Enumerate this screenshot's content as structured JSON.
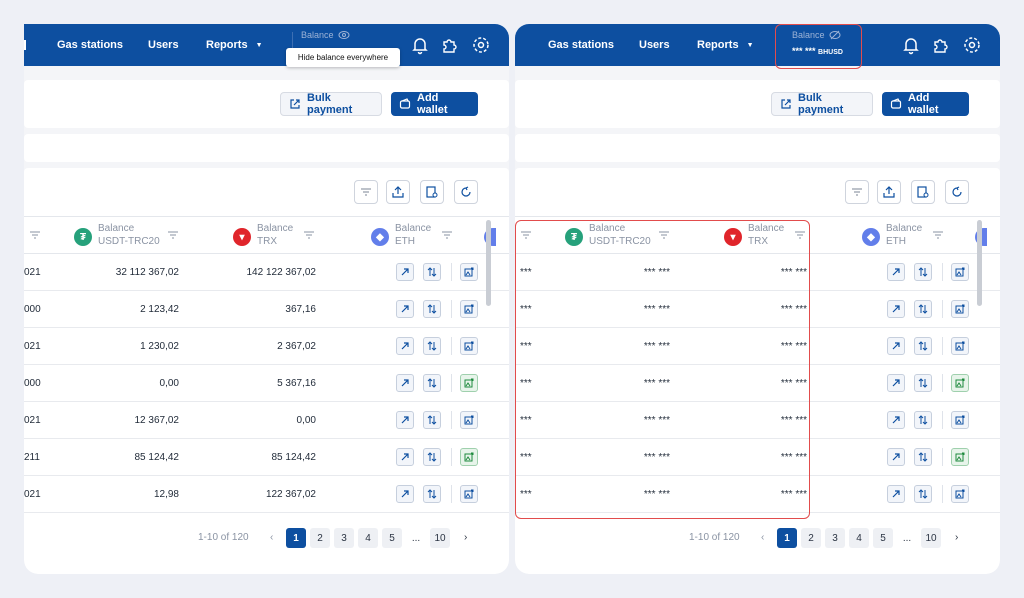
{
  "nav": {
    "gas_stations": "Gas stations",
    "users": "Users",
    "reports": "Reports"
  },
  "balance": {
    "label": "Balance",
    "tooltip": "Hide balance everywhere",
    "hidden_value": "*** ***",
    "hidden_currency": "BHUSD"
  },
  "toolbar": {
    "bulk_payment": "Bulk payment",
    "add_wallet": "Add wallet"
  },
  "columns": {
    "usdt": {
      "l1": "Balance",
      "l2": "USDT-TRC20"
    },
    "trx": {
      "l1": "Balance",
      "l2": "TRX"
    },
    "eth": {
      "l1": "Balance",
      "l2": "ETH"
    }
  },
  "rows": [
    {
      "cut": "021",
      "usdt": "32 112 367,02",
      "trx": "142 122 367,02",
      "green": false
    },
    {
      "cut": "000",
      "usdt": "2 123,42",
      "trx": "367,16",
      "green": false
    },
    {
      "cut": "021",
      "usdt": "1 230,02",
      "trx": "2 367,02",
      "green": false
    },
    {
      "cut": "000",
      "usdt": "0,00",
      "trx": "5 367,16",
      "green": true
    },
    {
      "cut": "021",
      "usdt": "12 367,02",
      "trx": "0,00",
      "green": false
    },
    {
      "cut": "211",
      "usdt": "85 124,42",
      "trx": "85 124,42",
      "green": true
    },
    {
      "cut": "021",
      "usdt": "12,98",
      "trx": "122 367,02",
      "green": false
    }
  ],
  "masked": {
    "first": "***",
    "usdt": "*** ***",
    "trx": "*** ***"
  },
  "pagination": {
    "range": "1-10 of 120",
    "pages": [
      "1",
      "2",
      "3",
      "4",
      "5",
      "...",
      "10"
    ],
    "active": "1"
  },
  "colors": {
    "brand": "#0d4fa0",
    "highlight": "#e24c4c",
    "usdt": "#26a17b",
    "trx": "#e0252b",
    "eth": "#627eea"
  }
}
